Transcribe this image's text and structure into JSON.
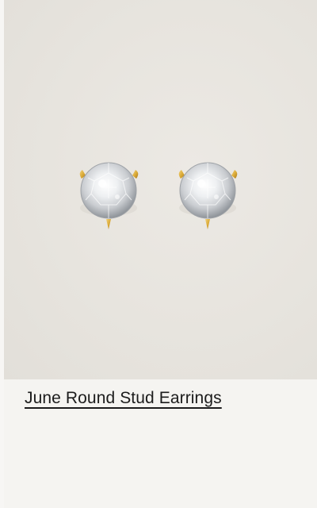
{
  "product": {
    "title": "June Round Stud Earrings",
    "image_description": "Pair of round diamond stud earrings with gold three-prong settings"
  },
  "colors": {
    "page_background": "#f5f4f1",
    "image_background": "#e7e4de",
    "title_text": "#1c1c1c",
    "gold": "#d9a935"
  },
  "icons": [
    "earring-left-icon",
    "earring-right-icon"
  ]
}
